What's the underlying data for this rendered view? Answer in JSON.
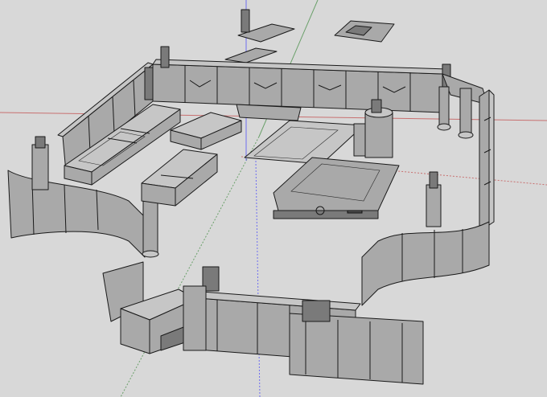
{
  "viewport": {
    "background": "#d8d8d8",
    "axis_colors": {
      "red": "#c87070",
      "green": "#6aa06a",
      "blue": "#6e6ef0"
    },
    "model_color": "#a9a9a9",
    "edge_color": "#1a1a1a"
  }
}
